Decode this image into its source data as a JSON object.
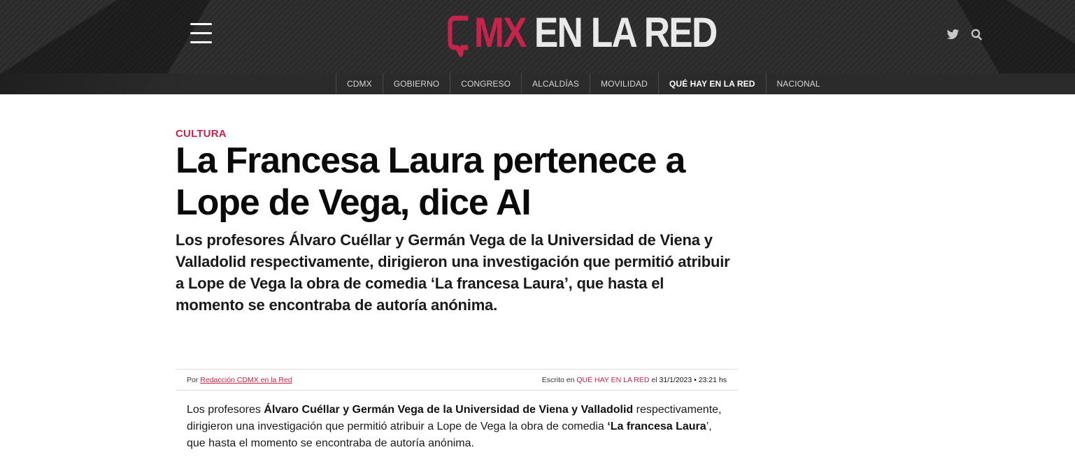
{
  "header": {
    "logo": {
      "mx": "MX",
      "name": "EN LA RED"
    },
    "nav": [
      {
        "label": "CDMX",
        "active": false
      },
      {
        "label": "GOBIERNO",
        "active": false
      },
      {
        "label": "CONGRESO",
        "active": false
      },
      {
        "label": "ALCALDÍAS",
        "active": false
      },
      {
        "label": "MOVILIDAD",
        "active": false
      },
      {
        "label": "QUÉ HAY EN LA RED",
        "active": true
      },
      {
        "label": "NACIONAL",
        "active": false
      }
    ],
    "icons": {
      "menu": "hamburger-menu-icon",
      "twitter": "twitter-icon",
      "search": "search-icon"
    }
  },
  "article": {
    "category": "CULTURA",
    "headline": "La Francesa Laura pertenece a Lope de Vega, dice AI",
    "dek": "Los profesores Álvaro Cuéllar y Germán Vega de la Universidad de Viena y Valladolid respectivamente, dirigieron una investigación que permitió atribuir a Lope de Vega la obra de comedia ‘La francesa Laura’, que hasta el momento se encontraba de autoría anónima.",
    "meta": {
      "by_prefix": "Por",
      "author": "Redacción CDMX en la Red",
      "written_prefix": "Escrito en",
      "section": "QUÉ HAY EN LA RED",
      "date_prefix": "el",
      "date": "31/1/2023 • 23:21 hs"
    },
    "body": {
      "p1_a": "Los profesores ",
      "p1_b": "Álvaro Cuéllar y Germán Vega de la Universidad de Viena y Valladolid",
      "p1_c": " respectivamente, dirigieron una investigación que permitió atribuir a Lope de Vega la obra de comedia ",
      "p1_d": "‘La francesa Laura",
      "p1_e": "’, que hasta el momento se encontraba de autoría anónima."
    }
  },
  "colors": {
    "accent": "#c8234a",
    "header_bg": "#2b2b2b"
  }
}
